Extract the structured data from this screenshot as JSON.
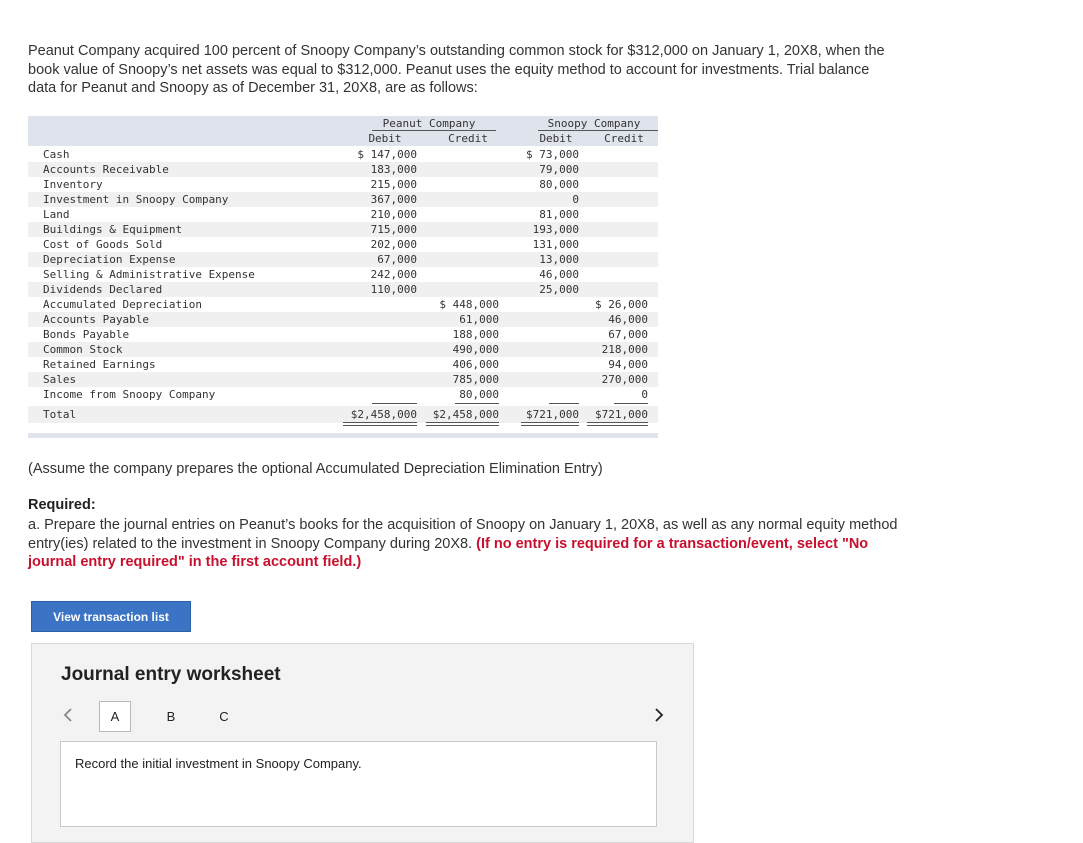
{
  "intro": {
    "line1": "Peanut Company acquired 100 percent of Snoopy Company’s outstanding common stock for $312,000 on January 1, 20X8, when the",
    "line2": "book value of Snoopy’s net assets was equal to $312,000. Peanut uses the equity method to account for investments. Trial balance",
    "line3": "data for Peanut and Snoopy as of December 31, 20X8, are as follows:"
  },
  "trial_balance": {
    "peanut_header": "Peanut Company",
    "snoopy_header": "Snoopy Company",
    "debit_label": "Debit",
    "credit_label": "Credit",
    "rows": [
      {
        "account": "Cash",
        "pd": "$ 147,000",
        "pc": "",
        "sd": "$ 73,000",
        "sc": ""
      },
      {
        "account": "Accounts Receivable",
        "pd": "183,000",
        "pc": "",
        "sd": "79,000",
        "sc": ""
      },
      {
        "account": "Inventory",
        "pd": "215,000",
        "pc": "",
        "sd": "80,000",
        "sc": ""
      },
      {
        "account": "Investment in Snoopy Company",
        "pd": "367,000",
        "pc": "",
        "sd": "0",
        "sc": ""
      },
      {
        "account": "Land",
        "pd": "210,000",
        "pc": "",
        "sd": "81,000",
        "sc": ""
      },
      {
        "account": "Buildings & Equipment",
        "pd": "715,000",
        "pc": "",
        "sd": "193,000",
        "sc": ""
      },
      {
        "account": "Cost of Goods Sold",
        "pd": "202,000",
        "pc": "",
        "sd": "131,000",
        "sc": ""
      },
      {
        "account": "Depreciation Expense",
        "pd": "67,000",
        "pc": "",
        "sd": "13,000",
        "sc": ""
      },
      {
        "account": "Selling & Administrative Expense",
        "pd": "242,000",
        "pc": "",
        "sd": "46,000",
        "sc": ""
      },
      {
        "account": "Dividends Declared",
        "pd": "110,000",
        "pc": "",
        "sd": "25,000",
        "sc": ""
      },
      {
        "account": "Accumulated Depreciation",
        "pd": "",
        "pc": "$ 448,000",
        "sd": "",
        "sc": "$ 26,000"
      },
      {
        "account": "Accounts Payable",
        "pd": "",
        "pc": "61,000",
        "sd": "",
        "sc": "46,000"
      },
      {
        "account": "Bonds Payable",
        "pd": "",
        "pc": "188,000",
        "sd": "",
        "sc": "67,000"
      },
      {
        "account": "Common Stock",
        "pd": "",
        "pc": "490,000",
        "sd": "",
        "sc": "218,000"
      },
      {
        "account": "Retained Earnings",
        "pd": "",
        "pc": "406,000",
        "sd": "",
        "sc": "94,000"
      },
      {
        "account": "Sales",
        "pd": "",
        "pc": "785,000",
        "sd": "",
        "sc": "270,000"
      },
      {
        "account": "Income from Snoopy Company",
        "pd": "",
        "pc": "80,000",
        "sd": "",
        "sc": "0"
      }
    ],
    "total": {
      "account": "Total",
      "pd": "$2,458,000",
      "pc": "$2,458,000",
      "sd": "$721,000",
      "sc": "$721,000"
    }
  },
  "note": "(Assume the company prepares the optional Accumulated Depreciation Elimination Entry)",
  "required": {
    "title": "Required:",
    "line1": "a. Prepare the journal entries on Peanut’s books for the acquisition of Snoopy on January 1, 20X8, as well as any normal equity method",
    "line2_plain": "entry(ies) related to the investment in Snoopy Company during 20X8.",
    "line2_red": "(If no entry is required for a transaction/event, select \"No",
    "line3_red": "journal entry required\" in the first account field.)"
  },
  "view_button": "View transaction list",
  "worksheet": {
    "title": "Journal entry worksheet",
    "prev_icon": "chevron-left-icon",
    "next_icon": "chevron-right-icon",
    "tabs": [
      "A",
      "B",
      "C"
    ],
    "active_tab": "A",
    "instruction": "Record the initial investment in Snoopy Company."
  }
}
